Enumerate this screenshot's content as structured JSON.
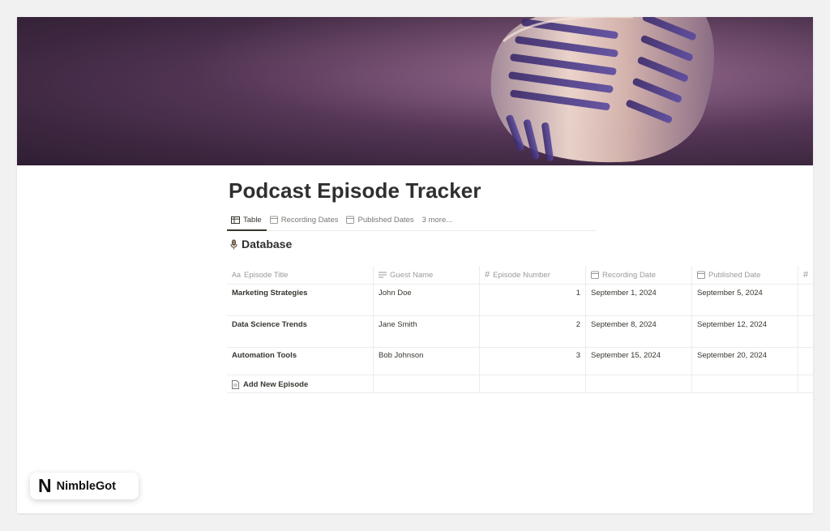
{
  "page": {
    "title": "Podcast Episode Tracker",
    "cover_image": "vintage-microphone"
  },
  "views": {
    "tabs": [
      {
        "label": "Table",
        "icon": "table-icon",
        "active": true
      },
      {
        "label": "Recording Dates",
        "icon": "calendar-icon",
        "active": false
      },
      {
        "label": "Published Dates",
        "icon": "calendar-icon",
        "active": false
      },
      {
        "label": "3 more...",
        "icon": "",
        "active": false
      }
    ]
  },
  "database": {
    "title": "Database",
    "title_icon": "microphone-icon",
    "columns": [
      {
        "label": "Episode Title",
        "icon": "text-type-icon",
        "icon_text": "Aa"
      },
      {
        "label": "Guest Name",
        "icon": "text-lines-icon"
      },
      {
        "label": "Episode Number",
        "icon": "number-icon",
        "icon_text": "#"
      },
      {
        "label": "Recording Date",
        "icon": "calendar-icon"
      },
      {
        "label": "Published Date",
        "icon": "calendar-icon"
      },
      {
        "label": "",
        "icon": "number-icon",
        "icon_text": "#"
      }
    ],
    "rows": [
      {
        "episode_title": "Marketing Strategies",
        "guest_name": "John Doe",
        "episode_number": "1",
        "recording_date": "September 1, 2024",
        "published_date": "September 5, 2024"
      },
      {
        "episode_title": "Data Science Trends",
        "guest_name": "Jane Smith",
        "episode_number": "2",
        "recording_date": "September 8, 2024",
        "published_date": "September 12, 2024"
      },
      {
        "episode_title": "Automation Tools",
        "guest_name": "Bob Johnson",
        "episode_number": "3",
        "recording_date": "September 15, 2024",
        "published_date": "September 20, 2024"
      }
    ],
    "add_row_label": "Add New Episode",
    "add_row_icon": "page-icon"
  },
  "brand": {
    "mark": "N",
    "name": "NimbleGot"
  },
  "colors": {
    "cover_base": "#4a2f4d",
    "text": "#37352f",
    "muted": "#9b9a97",
    "border": "#ececec"
  }
}
